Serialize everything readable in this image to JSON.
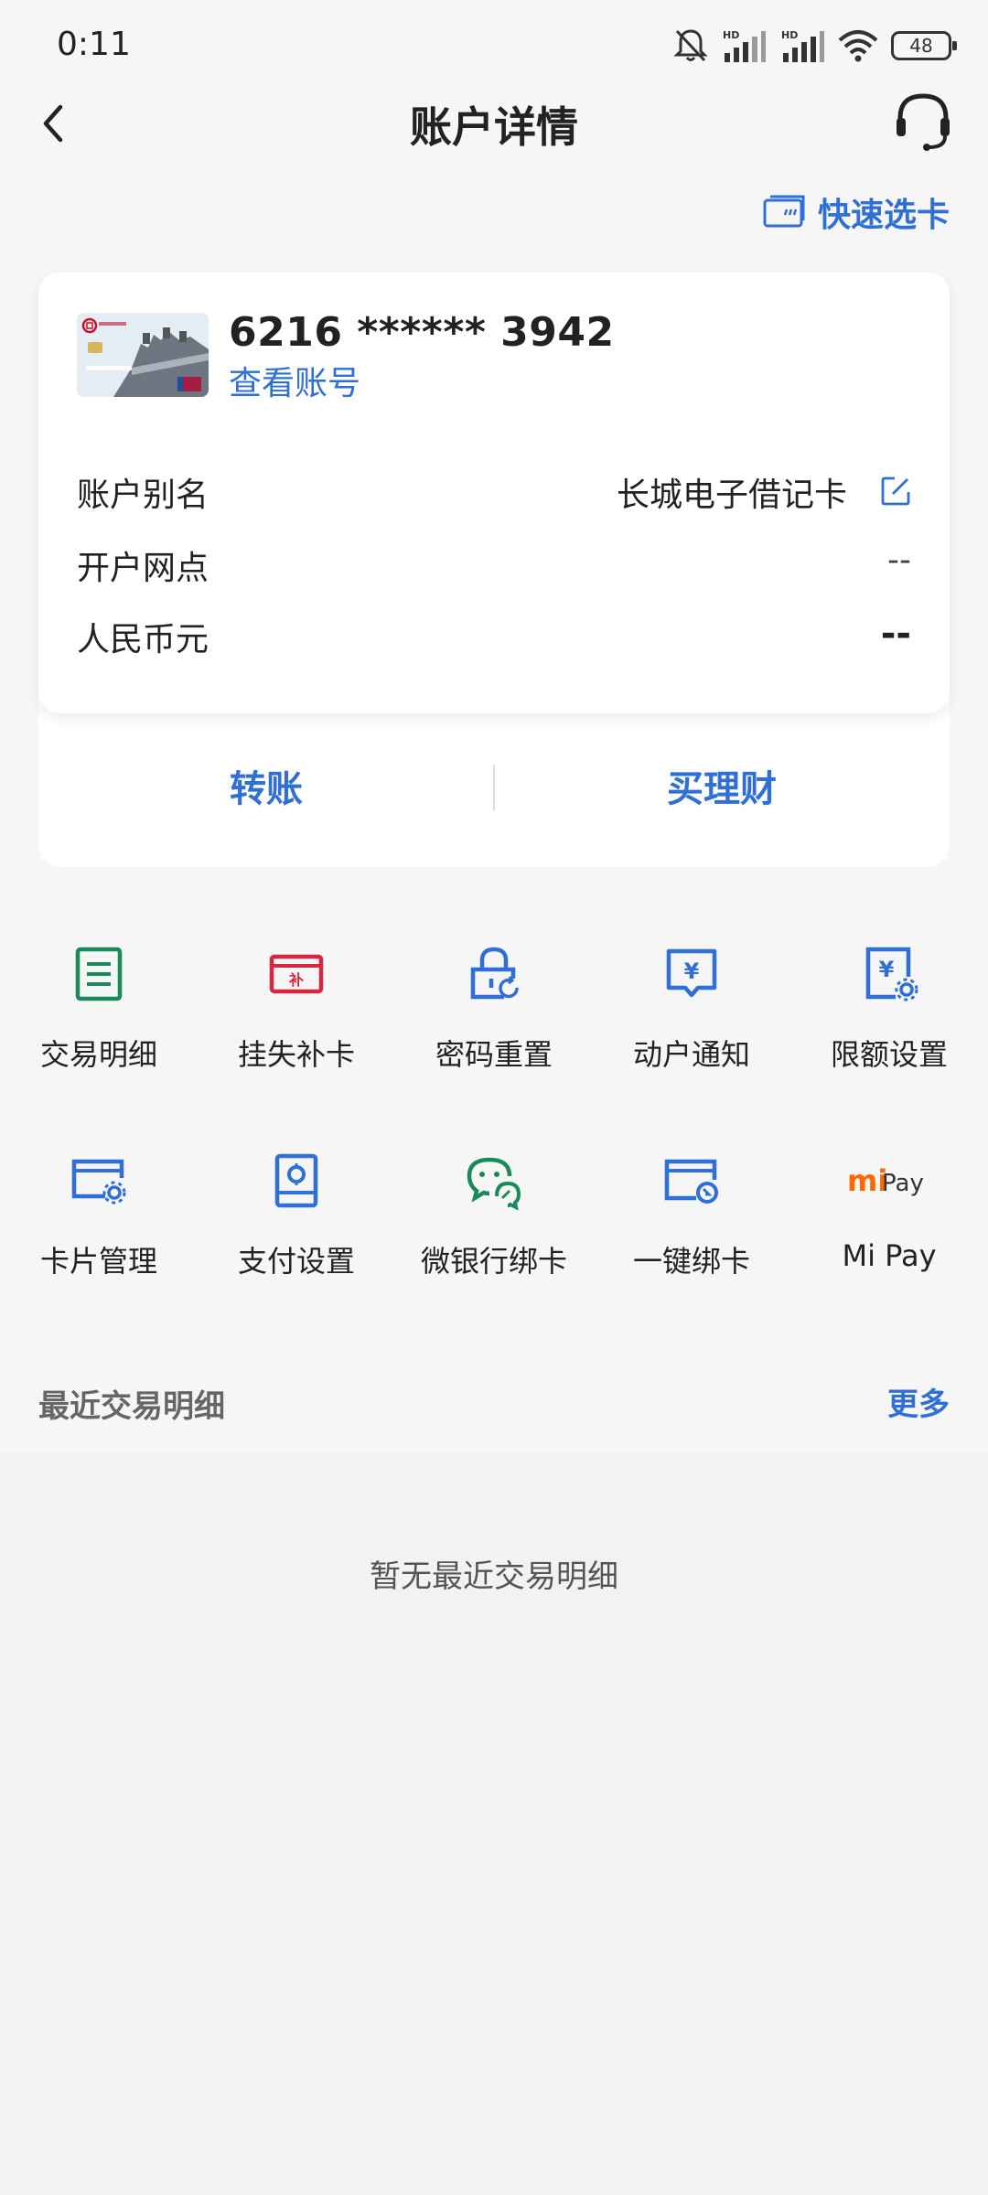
{
  "status_bar": {
    "time": "0:11",
    "battery": "48"
  },
  "header": {
    "title": "账户详情"
  },
  "quick_select": {
    "label": "快速选卡"
  },
  "card": {
    "number": "6216 ****** 3942",
    "view_account": "查看账号",
    "rows": [
      {
        "label": "账户别名",
        "value": "长城电子借记卡"
      },
      {
        "label": "开户网点",
        "value": "--"
      },
      {
        "label": "人民币元",
        "value": "--"
      }
    ],
    "actions": {
      "transfer": "转账",
      "buy_finance": "买理财"
    }
  },
  "grid": [
    {
      "label": "交易明细",
      "icon": "transaction-list-icon",
      "color": "#1b8a5a"
    },
    {
      "label": "挂失补卡",
      "icon": "report-loss-icon",
      "color": "#d7263d"
    },
    {
      "label": "密码重置",
      "icon": "password-reset-icon",
      "color": "#2f6fd6"
    },
    {
      "label": "动户通知",
      "icon": "account-notice-icon",
      "color": "#2f6fd6"
    },
    {
      "label": "限额设置",
      "icon": "limit-settings-icon",
      "color": "#2f6fd6"
    },
    {
      "label": "卡片管理",
      "icon": "card-manage-icon",
      "color": "#2f6fd6"
    },
    {
      "label": "支付设置",
      "icon": "payment-settings-icon",
      "color": "#2f6fd6"
    },
    {
      "label": "微银行绑卡",
      "icon": "wechat-bind-icon",
      "color": "#1b8a5a"
    },
    {
      "label": "一键绑卡",
      "icon": "one-click-bind-icon",
      "color": "#2f6fd6"
    },
    {
      "label": "Mi Pay",
      "icon": "mi-pay-icon",
      "logo_mi": "mi",
      "logo_pay": "Pay",
      "color": "#ff6900"
    }
  ],
  "recent": {
    "title": "最近交易明细",
    "more": "更多",
    "empty": "暂无最近交易明细"
  },
  "colors": {
    "accent": "#2f6fd6",
    "green": "#1b8a5a",
    "red": "#d7263d"
  }
}
